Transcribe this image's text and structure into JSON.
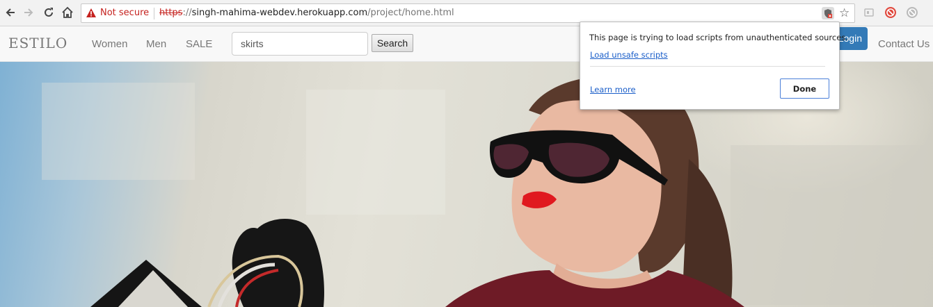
{
  "browser": {
    "security_label": "Not secure",
    "url_scheme": "https",
    "url_sep": "://",
    "url_host": "singh-mahima-webdev.herokuapp.com",
    "url_path": "/project/home.html"
  },
  "site": {
    "brand": "ESTILO",
    "nav": [
      "Women",
      "Men",
      "SALE"
    ],
    "search_value": "skirts",
    "search_button": "Search",
    "login_label": "Login",
    "contact_label": "Contact Us",
    "accent_color": "#337ab7"
  },
  "popup": {
    "message": "This page is trying to load scripts from unauthenticated sources.",
    "load_link": "Load unsafe scripts",
    "learn_link": "Learn more",
    "done_button": "Done"
  },
  "icons": {
    "back": "back-arrow-icon",
    "forward": "forward-arrow-icon",
    "reload": "reload-icon",
    "home": "home-icon",
    "warning": "warning-triangle-icon",
    "shield": "blocked-content-shield-icon",
    "bookmark": "star-icon",
    "extensions": [
      "reader-extension-icon",
      "adblock-extension-icon",
      "blocked-extension-icon"
    ]
  }
}
